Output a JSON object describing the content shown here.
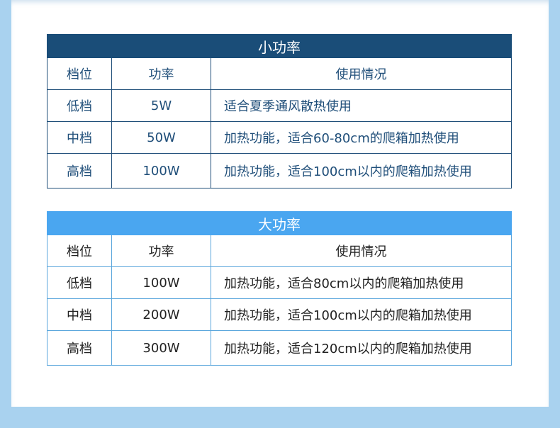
{
  "tables": [
    {
      "title": "小功率",
      "headers": [
        "档位",
        "功率",
        "使用情况"
      ],
      "rows": [
        [
          "低档",
          "5W",
          "适合夏季通风散热使用"
        ],
        [
          "中档",
          "50W",
          "加热功能，适合60-80cm的爬箱加热使用"
        ],
        [
          "高档",
          "100W",
          "加热功能，适合100cm以内的爬箱加热使用"
        ]
      ]
    },
    {
      "title": "大功率",
      "headers": [
        "档位",
        "功率",
        "使用情况"
      ],
      "rows": [
        [
          "低档",
          "100W",
          "加热功能，适合80cm以内的爬箱加热使用"
        ],
        [
          "中档",
          "200W",
          "加热功能，适合100cm以内的爬箱加热使用"
        ],
        [
          "高档",
          "300W",
          "加热功能，适合120cm以内的爬箱加热使用"
        ]
      ]
    }
  ],
  "colors": {
    "small_header": "#1a4d78",
    "large_header": "#4aa6f0",
    "frame": "#a9d2ef"
  }
}
